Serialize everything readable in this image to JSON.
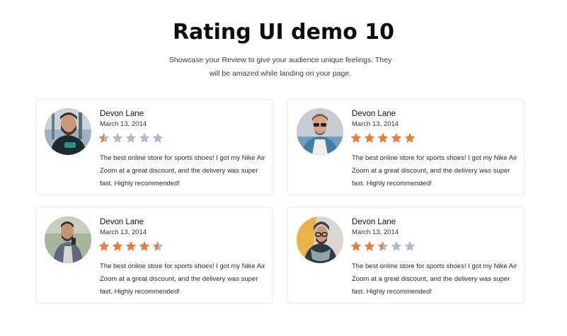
{
  "header": {
    "title": "Rating UI demo 10",
    "subtitle": "Showcase your Review to give your audience unique feelings. They will be amazed while landing on your page."
  },
  "colors": {
    "star_filled": "#ee7b38",
    "star_empty": "#b3b8c6"
  },
  "reviews": [
    {
      "name": "Devon Lane",
      "date": "March 13, 2014",
      "rating": 0.5,
      "max_rating": 5,
      "text": "The best online store for sports shoes! I got my Nike Air Zoom at a great discount, and the delivery was super fast. Highly recommended!"
    },
    {
      "name": "Devon Lane",
      "date": "March 13, 2014",
      "rating": 5,
      "max_rating": 5,
      "text": "The best online store for sports shoes! I got my Nike Air Zoom at a great discount, and the delivery was super fast. Highly recommended!"
    },
    {
      "name": "Devon Lane",
      "date": "March 13, 2014",
      "rating": 4.5,
      "max_rating": 5,
      "text": "The best online store for sports shoes! I got my Nike Air Zoom at a great discount, and the delivery was super fast. Highly recommended!"
    },
    {
      "name": "Devon Lane",
      "date": "March 13, 2014",
      "rating": 2.5,
      "max_rating": 5,
      "text": "The best online store for sports shoes! I got my Nike Air Zoom at a great discount, and the delivery was super fast. Highly recommended!"
    }
  ]
}
